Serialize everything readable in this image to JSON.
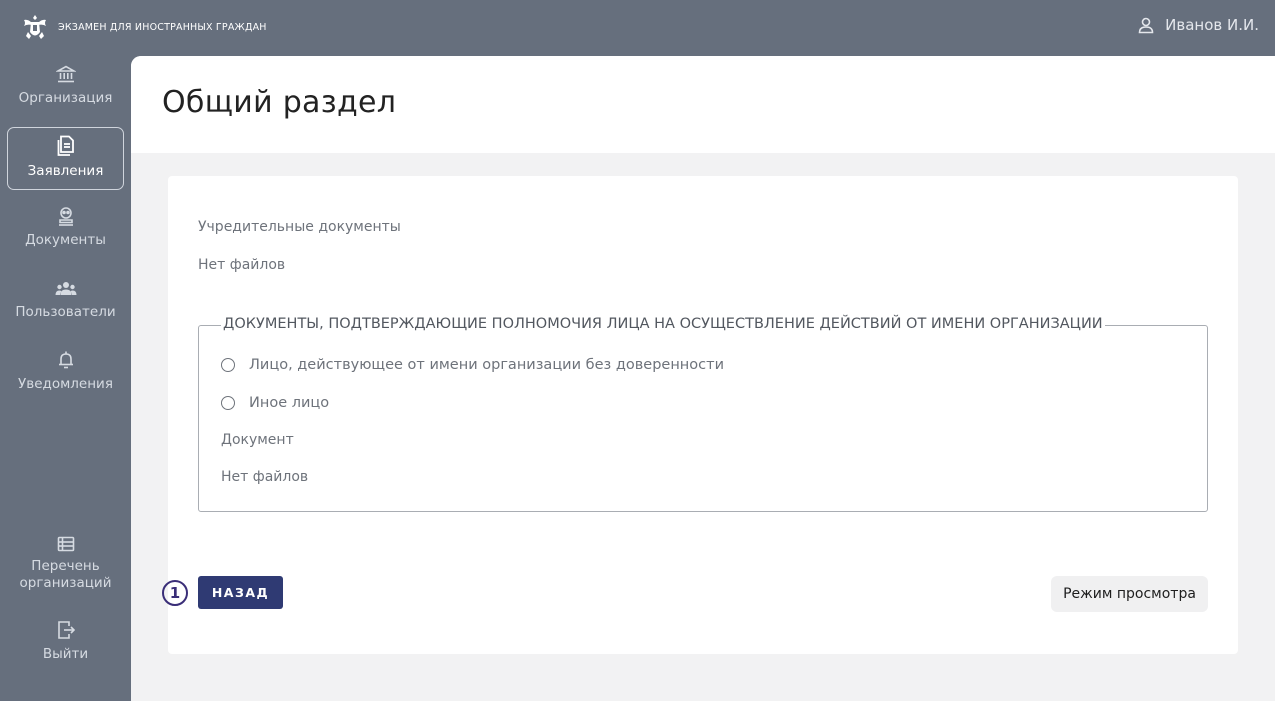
{
  "header": {
    "app_title": "ЭКЗАМЕН ДЛЯ ИНОСТРАННЫХ ГРАЖДАН",
    "user_name": "Иванов И.И."
  },
  "sidebar": {
    "items": [
      {
        "label": "Организация",
        "icon": "bank-icon",
        "active": false
      },
      {
        "label": "Заявления",
        "icon": "document-copy-icon",
        "active": true
      },
      {
        "label": "Документы",
        "icon": "stamp-icon",
        "active": false
      },
      {
        "label": "Пользователи",
        "icon": "users-icon",
        "active": false
      },
      {
        "label": "Уведомления",
        "icon": "bell-icon",
        "active": false
      }
    ],
    "bottom_items": [
      {
        "label_line1": "Перечень",
        "label_line2": "организаций",
        "icon": "list-icon"
      },
      {
        "label": "Выйти",
        "icon": "logout-icon"
      }
    ]
  },
  "page": {
    "title": "Общий раздел"
  },
  "form": {
    "founding_docs_label": "Учредительные документы",
    "founding_docs_value": "Нет файлов",
    "authority_section": {
      "legend": "ДОКУМЕНТЫ, ПОДТВЕРЖДАЮЩИЕ ПОЛНОМОЧИЯ ЛИЦА НА ОСУЩЕСТВЛЕНИЕ ДЕЙСТВИЙ ОТ ИМЕНИ ОРГАНИЗАЦИИ",
      "options": [
        "Лицо, действующее от имени организации без доверенности",
        "Иное лицо"
      ],
      "document_label": "Документ",
      "document_value": "Нет файлов"
    }
  },
  "actions": {
    "step_number": "1",
    "back_label": "НАЗАД",
    "view_mode_label": "Режим просмотра"
  },
  "colors": {
    "sidebar_bg": "#666f7d",
    "primary_button": "#2f3a73",
    "step_marker": "#3a2e78"
  }
}
